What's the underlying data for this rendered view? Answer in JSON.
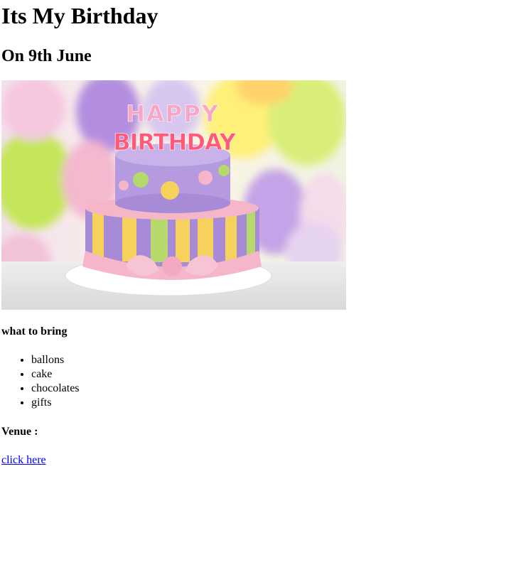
{
  "heading": "Its My Birthday",
  "subheading": "On 9th June",
  "image": {
    "cake_text_top": "HAPPY",
    "cake_text_bottom": "BIRTHDAY"
  },
  "bring": {
    "title": "what to bring",
    "items": [
      "ballons",
      "cake",
      "chocolates",
      "gifts"
    ]
  },
  "venue": {
    "title": "Venue :",
    "link_text": "click here"
  },
  "colors": {
    "link": "#0000ee",
    "cake_purple": "#a78bd6",
    "ribbon_pink": "#f4b6c8"
  }
}
